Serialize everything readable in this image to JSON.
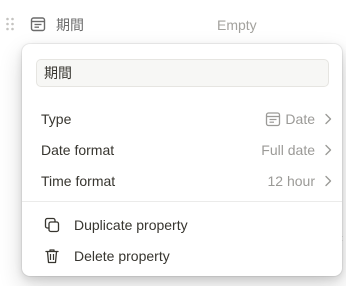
{
  "property_row": {
    "name": "期間",
    "value": "Empty",
    "icon": "calendar-icon",
    "drag_icon": "drag-handle-icon"
  },
  "popover": {
    "name_input_value": "期間",
    "menu": [
      {
        "label": "Type",
        "value": "Date",
        "value_icon": "calendar-icon"
      },
      {
        "label": "Date format",
        "value": "Full date"
      },
      {
        "label": "Time format",
        "value": "12 hour"
      }
    ],
    "actions": [
      {
        "label": "Duplicate property",
        "icon": "duplicate-icon"
      },
      {
        "label": "Delete property",
        "icon": "trash-icon"
      }
    ]
  },
  "colors": {
    "text": "#37352f",
    "muted": "#9b9a97",
    "input_bg": "#f7f7f5"
  }
}
